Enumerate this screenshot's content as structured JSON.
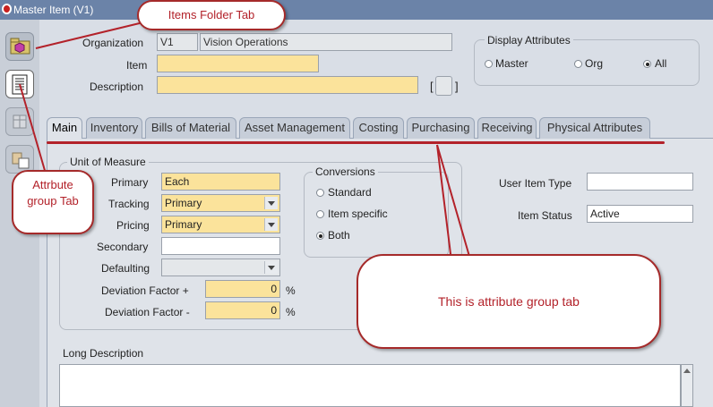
{
  "window": {
    "title": "Master Item (V1)"
  },
  "header": {
    "organization_label": "Organization",
    "org_code": "V1",
    "org_name": "Vision Operations",
    "item_label": "Item",
    "item_value": "",
    "description_label": "Description",
    "description_value": "",
    "flex_bracket_left": "[",
    "flex_bracket_right": "]"
  },
  "display_attributes": {
    "title": "Display Attributes",
    "options": [
      "Master",
      "Org",
      "All"
    ],
    "selected": "All"
  },
  "tabs": [
    "Main",
    "Inventory",
    "Bills of Material",
    "Asset Management",
    "Costing",
    "Purchasing",
    "Receiving",
    "Physical Attributes"
  ],
  "active_tab": "Main",
  "uom": {
    "title": "Unit of Measure",
    "primary_label": "Primary",
    "primary_value": "Each",
    "tracking_label": "Tracking",
    "tracking_value": "Primary",
    "pricing_label": "Pricing",
    "pricing_value": "Primary",
    "secondary_label": "Secondary",
    "secondary_value": "",
    "defaulting_label": "Defaulting",
    "defaulting_value": "",
    "dev_plus_label": "Deviation Factor +",
    "dev_plus_value": "0",
    "dev_minus_label": "Deviation Factor -",
    "dev_minus_value": "0",
    "percent": "%"
  },
  "conversions": {
    "title": "Conversions",
    "options": [
      "Standard",
      "Item specific",
      "Both"
    ],
    "selected": "Both"
  },
  "right_fields": {
    "user_item_type_label": "User Item Type",
    "user_item_type_value": "",
    "item_status_label": "Item Status",
    "item_status_value": "Active"
  },
  "long_description": {
    "label": "Long Description",
    "value": ""
  },
  "annotations": {
    "items_folder": "Items Folder Tab",
    "attribute_group": "Attrbute group Tab",
    "attr_group_note": "This is attribute group tab",
    "color": "#b3222a"
  }
}
